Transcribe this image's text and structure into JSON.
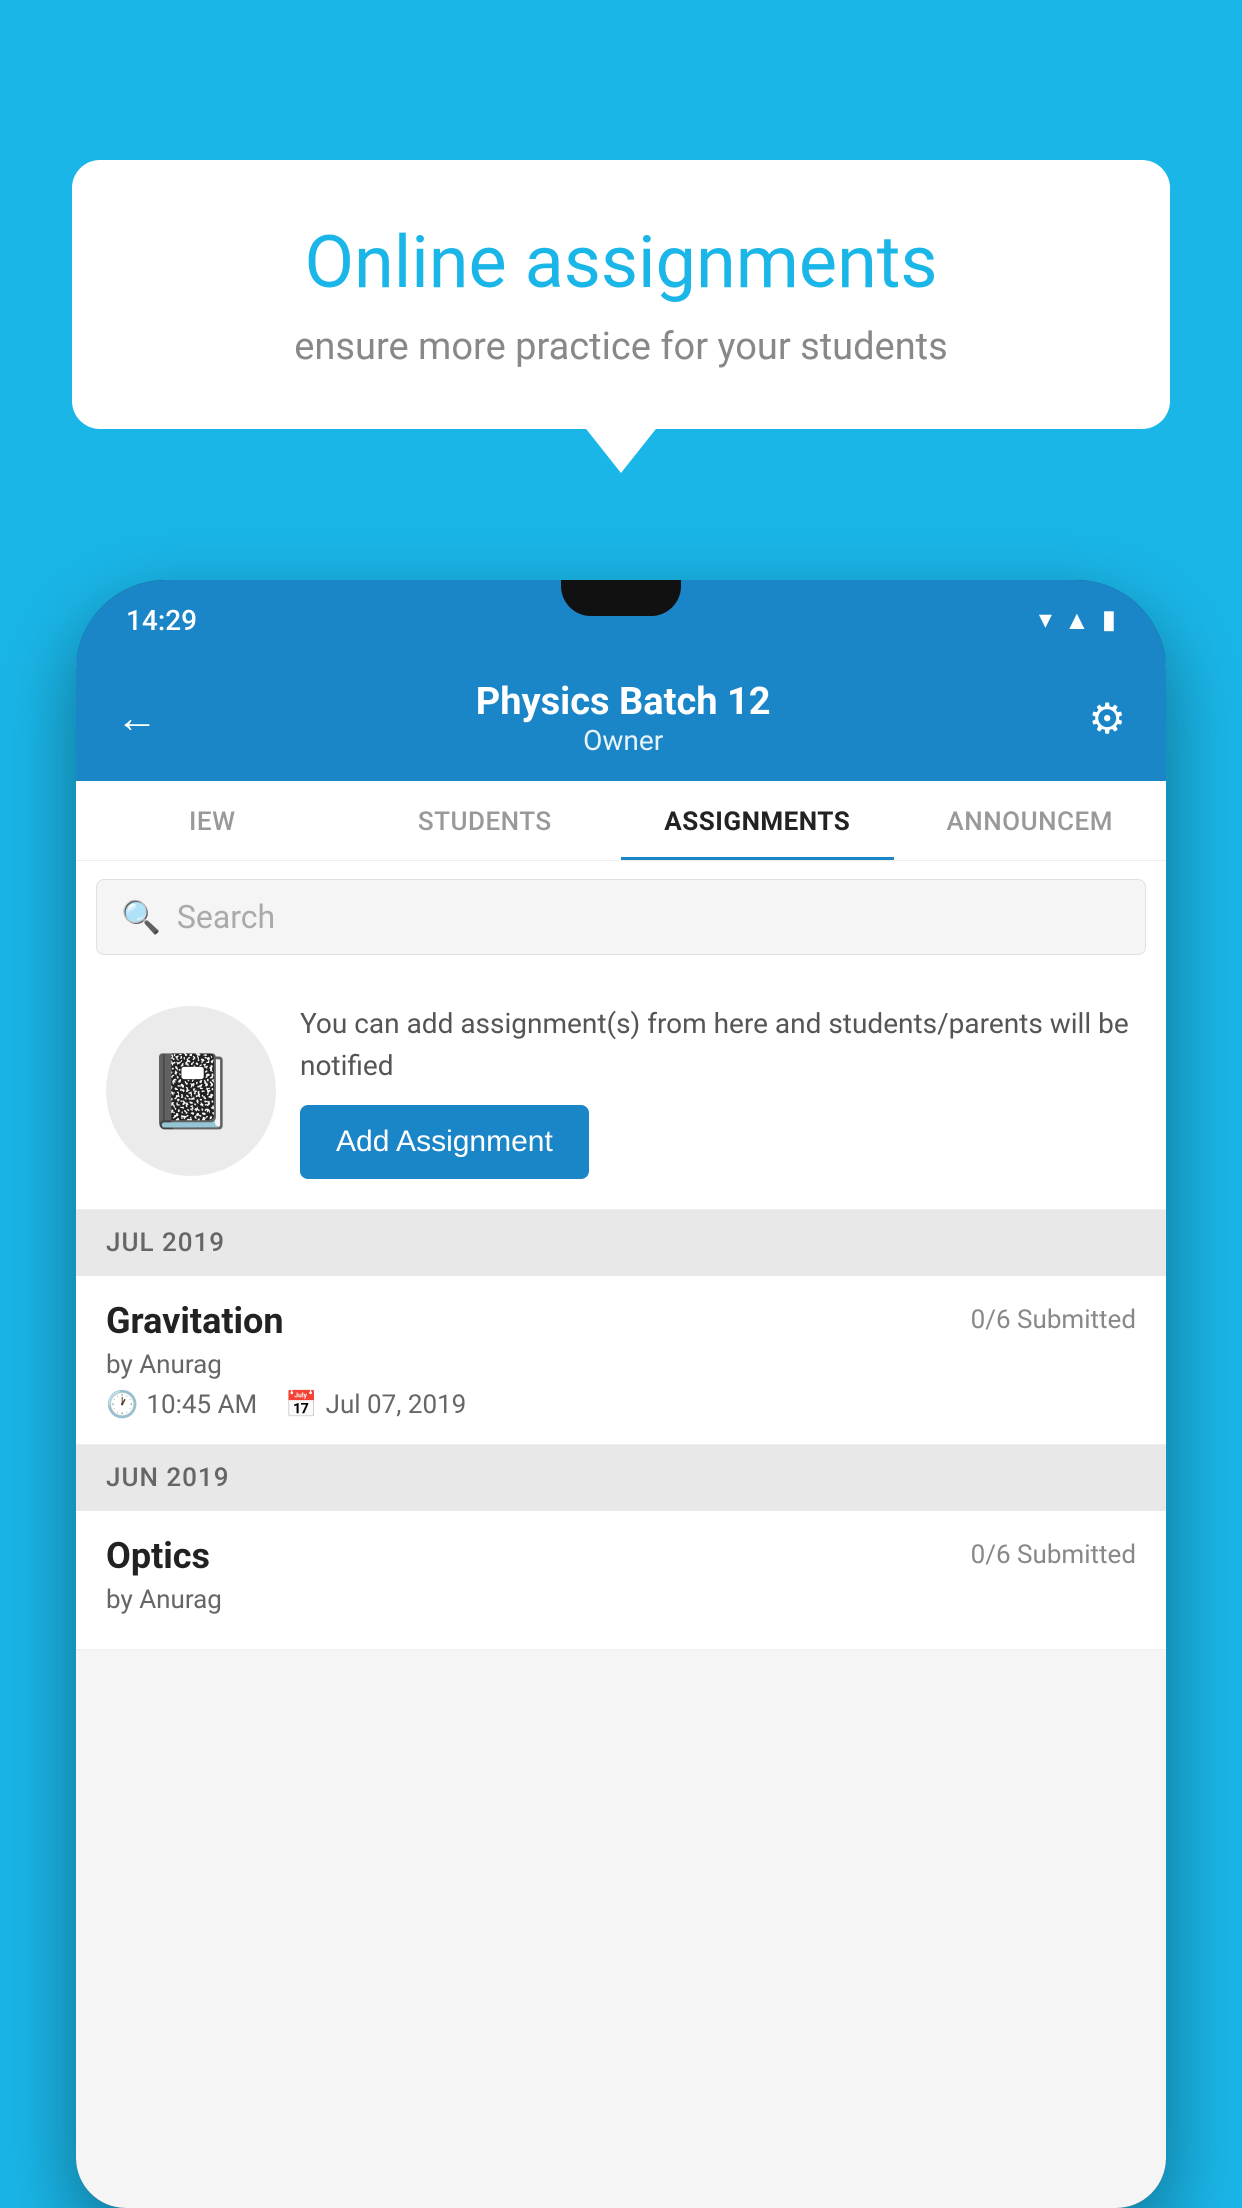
{
  "background_color": "#1ab6e8",
  "speech_bubble": {
    "title": "Online assignments",
    "subtitle": "ensure more practice for your students"
  },
  "phone": {
    "status_bar": {
      "time": "14:29"
    },
    "header": {
      "title": "Physics Batch 12",
      "subtitle": "Owner"
    },
    "tabs": [
      {
        "label": "IEW",
        "active": false
      },
      {
        "label": "STUDENTS",
        "active": false
      },
      {
        "label": "ASSIGNMENTS",
        "active": true
      },
      {
        "label": "ANNOUNCEME",
        "active": false
      }
    ],
    "search": {
      "placeholder": "Search"
    },
    "promo": {
      "description": "You can add assignment(s) from here and students/parents will be notified",
      "button_label": "Add Assignment"
    },
    "sections": [
      {
        "label": "JUL 2019",
        "assignments": [
          {
            "name": "Gravitation",
            "submitted": "0/6 Submitted",
            "by": "by Anurag",
            "time": "10:45 AM",
            "date": "Jul 07, 2019"
          }
        ]
      },
      {
        "label": "JUN 2019",
        "assignments": [
          {
            "name": "Optics",
            "submitted": "0/6 Submitted",
            "by": "by Anurag",
            "time": "",
            "date": ""
          }
        ]
      }
    ]
  }
}
